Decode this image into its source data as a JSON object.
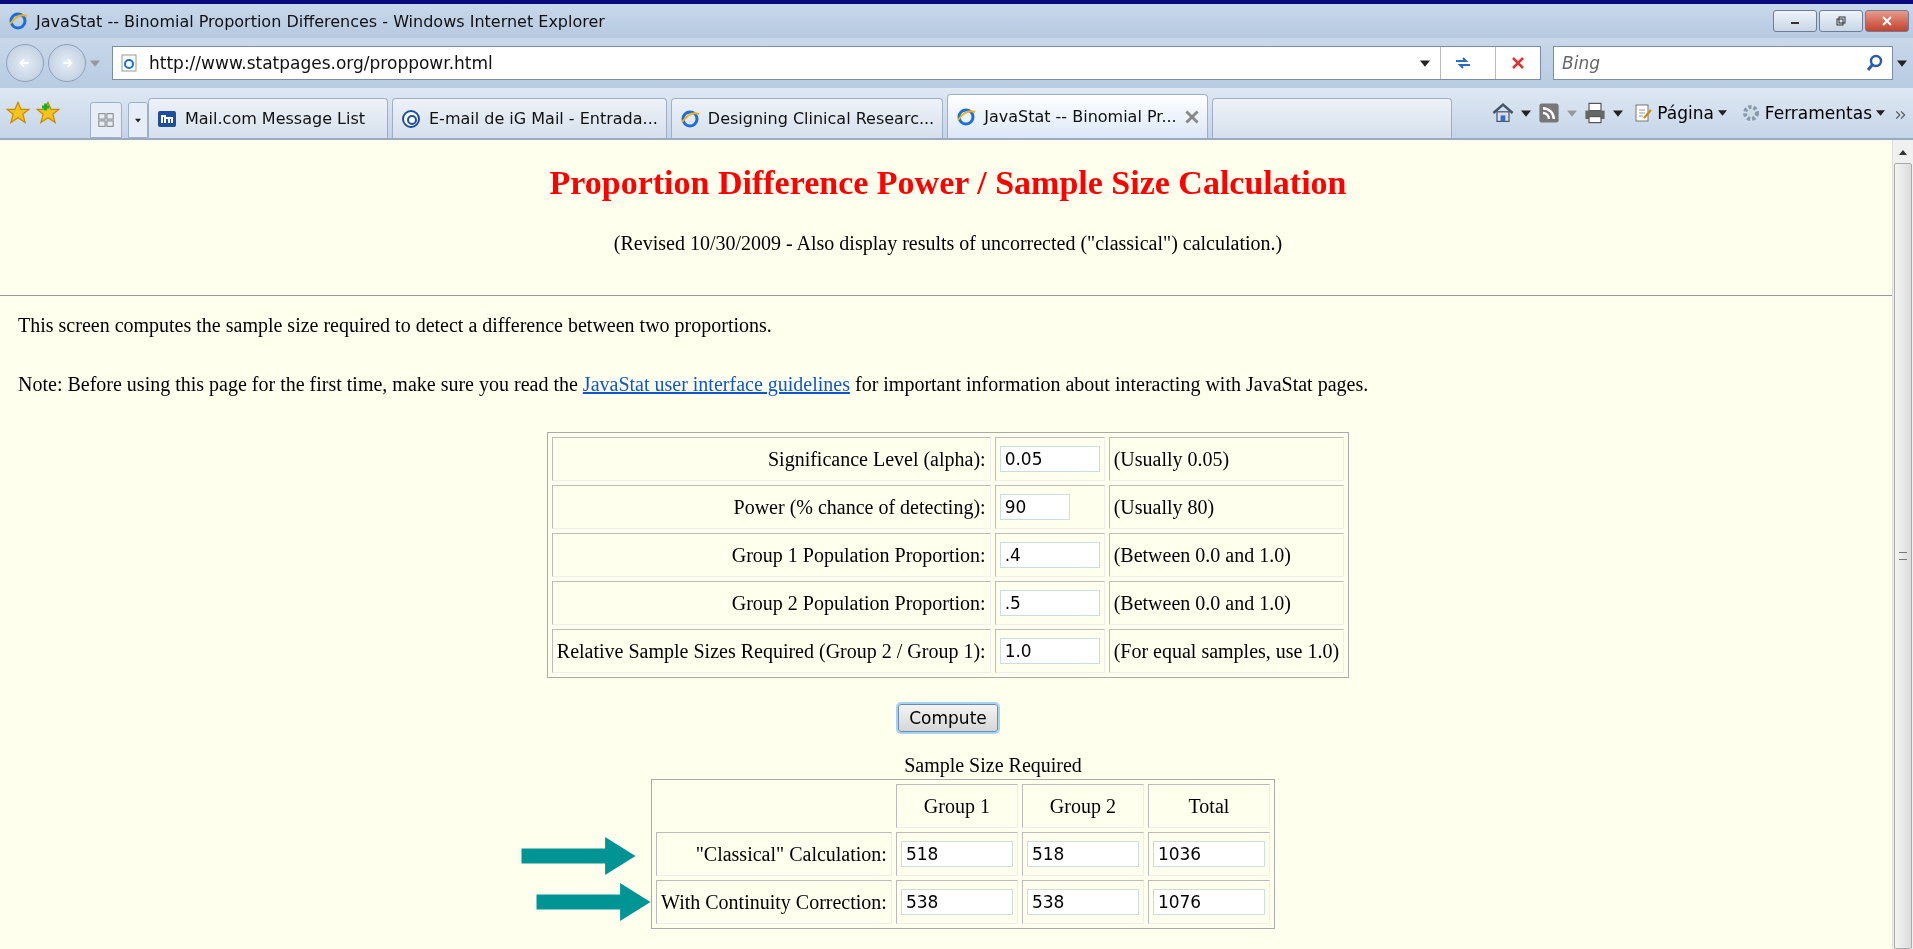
{
  "window": {
    "title": "JavaStat -- Binomial Proportion Differences - Windows Internet Explorer"
  },
  "address_bar": {
    "url": "http://www.statpages.org/proppowr.html"
  },
  "search": {
    "placeholder": "Bing"
  },
  "tabs": [
    {
      "label": "Mail.com Message List",
      "selected": false
    },
    {
      "label": "E-mail de iG Mail - Entrada...",
      "selected": false
    },
    {
      "label": "Designing Clinical Researc...",
      "selected": false
    },
    {
      "label": "JavaStat -- Binomial Pr...",
      "selected": true
    }
  ],
  "command_bar": {
    "page": "Página",
    "tools": "Ferramentas"
  },
  "page": {
    "heading": "Proportion Difference Power / Sample Size Calculation",
    "revision": "(Revised 10/30/2009 - Also display results of uncorrected (\"classical\") calculation.)",
    "intro": "This screen computes the sample size required to detect a difference between two proportions.",
    "note_before": "Note: Before using this page for the first time, make sure you read the",
    "note_link": "JavaStat user interface guidelines",
    "note_after": "for important information about interacting with JavaStat pages.",
    "inputs": [
      {
        "label": "Significance Level (alpha):",
        "value": "0.05",
        "hint": "(Usually 0.05)"
      },
      {
        "label": "Power (% chance of detecting):",
        "value": "90",
        "hint": "(Usually 80)"
      },
      {
        "label": "Group 1 Population Proportion:",
        "value": ".4",
        "hint": "(Between 0.0 and 1.0)"
      },
      {
        "label": "Group 2 Population Proportion:",
        "value": ".5",
        "hint": "(Between 0.0 and 1.0)"
      },
      {
        "label": "Relative Sample Sizes Required (Group 2 / Group 1):",
        "value": "1.0",
        "hint": "(For equal samples, use 1.0)"
      }
    ],
    "compute_button": "Compute",
    "results": {
      "caption": "Sample Size Required",
      "columns": [
        "Group 1",
        "Group 2",
        "Total"
      ],
      "rows": [
        {
          "label": "\"Classical\" Calculation:",
          "values": [
            "518",
            "518",
            "1036"
          ],
          "arrow": true
        },
        {
          "label": "With Continuity Correction:",
          "values": [
            "538",
            "538",
            "1076"
          ],
          "arrow": true
        }
      ]
    }
  }
}
